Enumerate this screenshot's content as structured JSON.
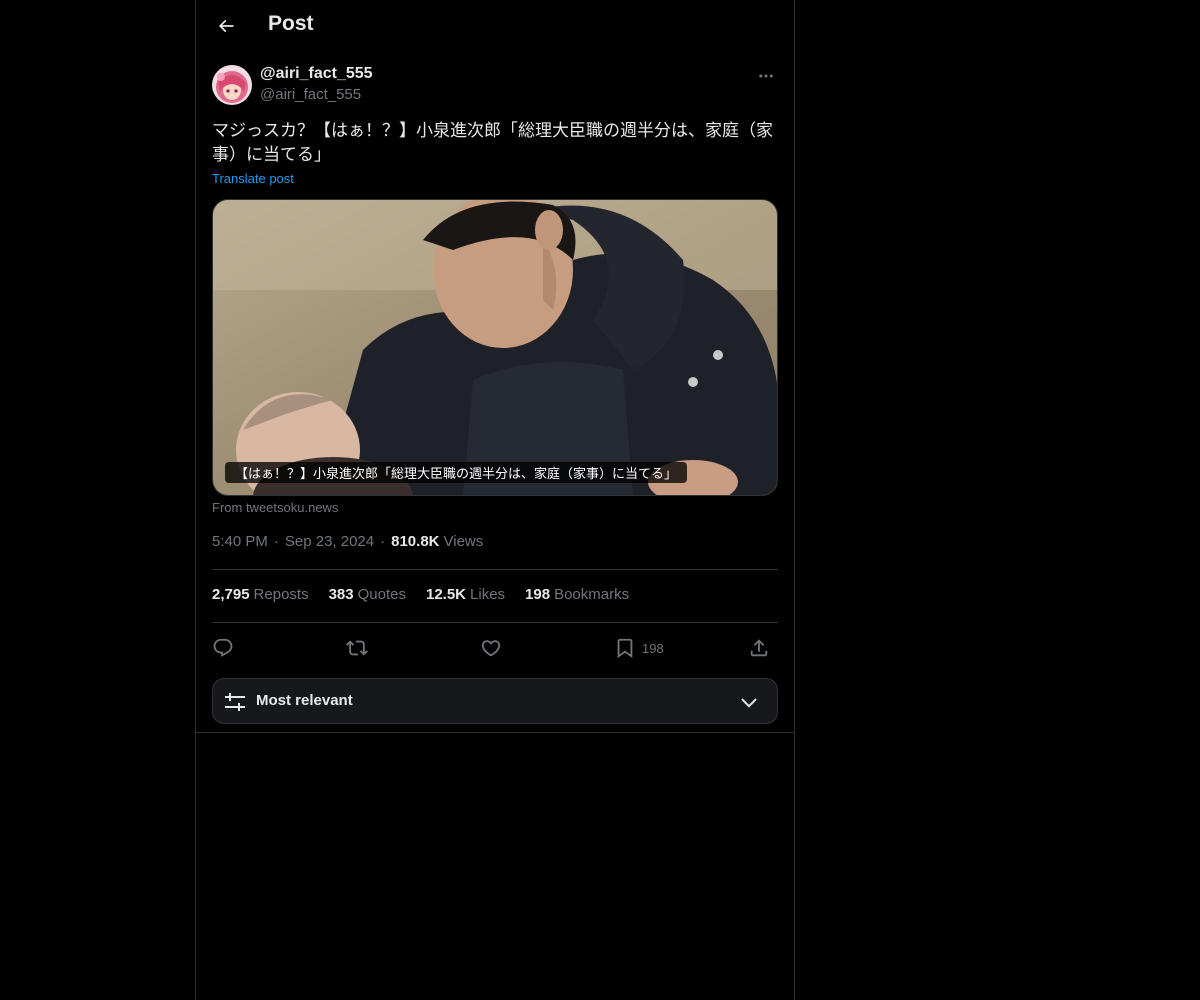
{
  "header": {
    "title": "Post",
    "back_icon": "arrow-left-icon"
  },
  "post": {
    "author": {
      "display_name": "@airi_fact_555",
      "handle": "@airi_fact_555"
    },
    "text": "マジっスカ？【はぁ！？】小泉進次郎「総理大臣職の週半分は、家庭（家事）に当てる」",
    "translate_label": "Translate post",
    "card": {
      "caption": "【はぁ！？】小泉進次郎「総理大臣職の週半分は、家庭（家事）に当てる」",
      "source": "From tweetsoku.news"
    },
    "time": "5:40 PM",
    "date": "Sep 23, 2024",
    "views_count": "810.8K",
    "views_label": "Views"
  },
  "stats": {
    "reposts_count": "2,795",
    "reposts_label": "Reposts",
    "quotes_count": "383",
    "quotes_label": "Quotes",
    "likes_count": "12.5K",
    "likes_label": "Likes",
    "bookmarks_count": "198",
    "bookmarks_label": "Bookmarks"
  },
  "actions": {
    "reply_icon": "reply-icon",
    "repost_icon": "repost-icon",
    "like_icon": "heart-icon",
    "bookmark_icon": "bookmark-icon",
    "bookmark_count": "198",
    "share_icon": "share-icon"
  },
  "sort": {
    "label": "Most relevant"
  },
  "colors": {
    "background": "#000000",
    "text_primary": "#e7e9ea",
    "text_secondary": "#71767b",
    "accent": "#1d9bf0",
    "border": "#2f3336",
    "panel": "#16181c"
  }
}
